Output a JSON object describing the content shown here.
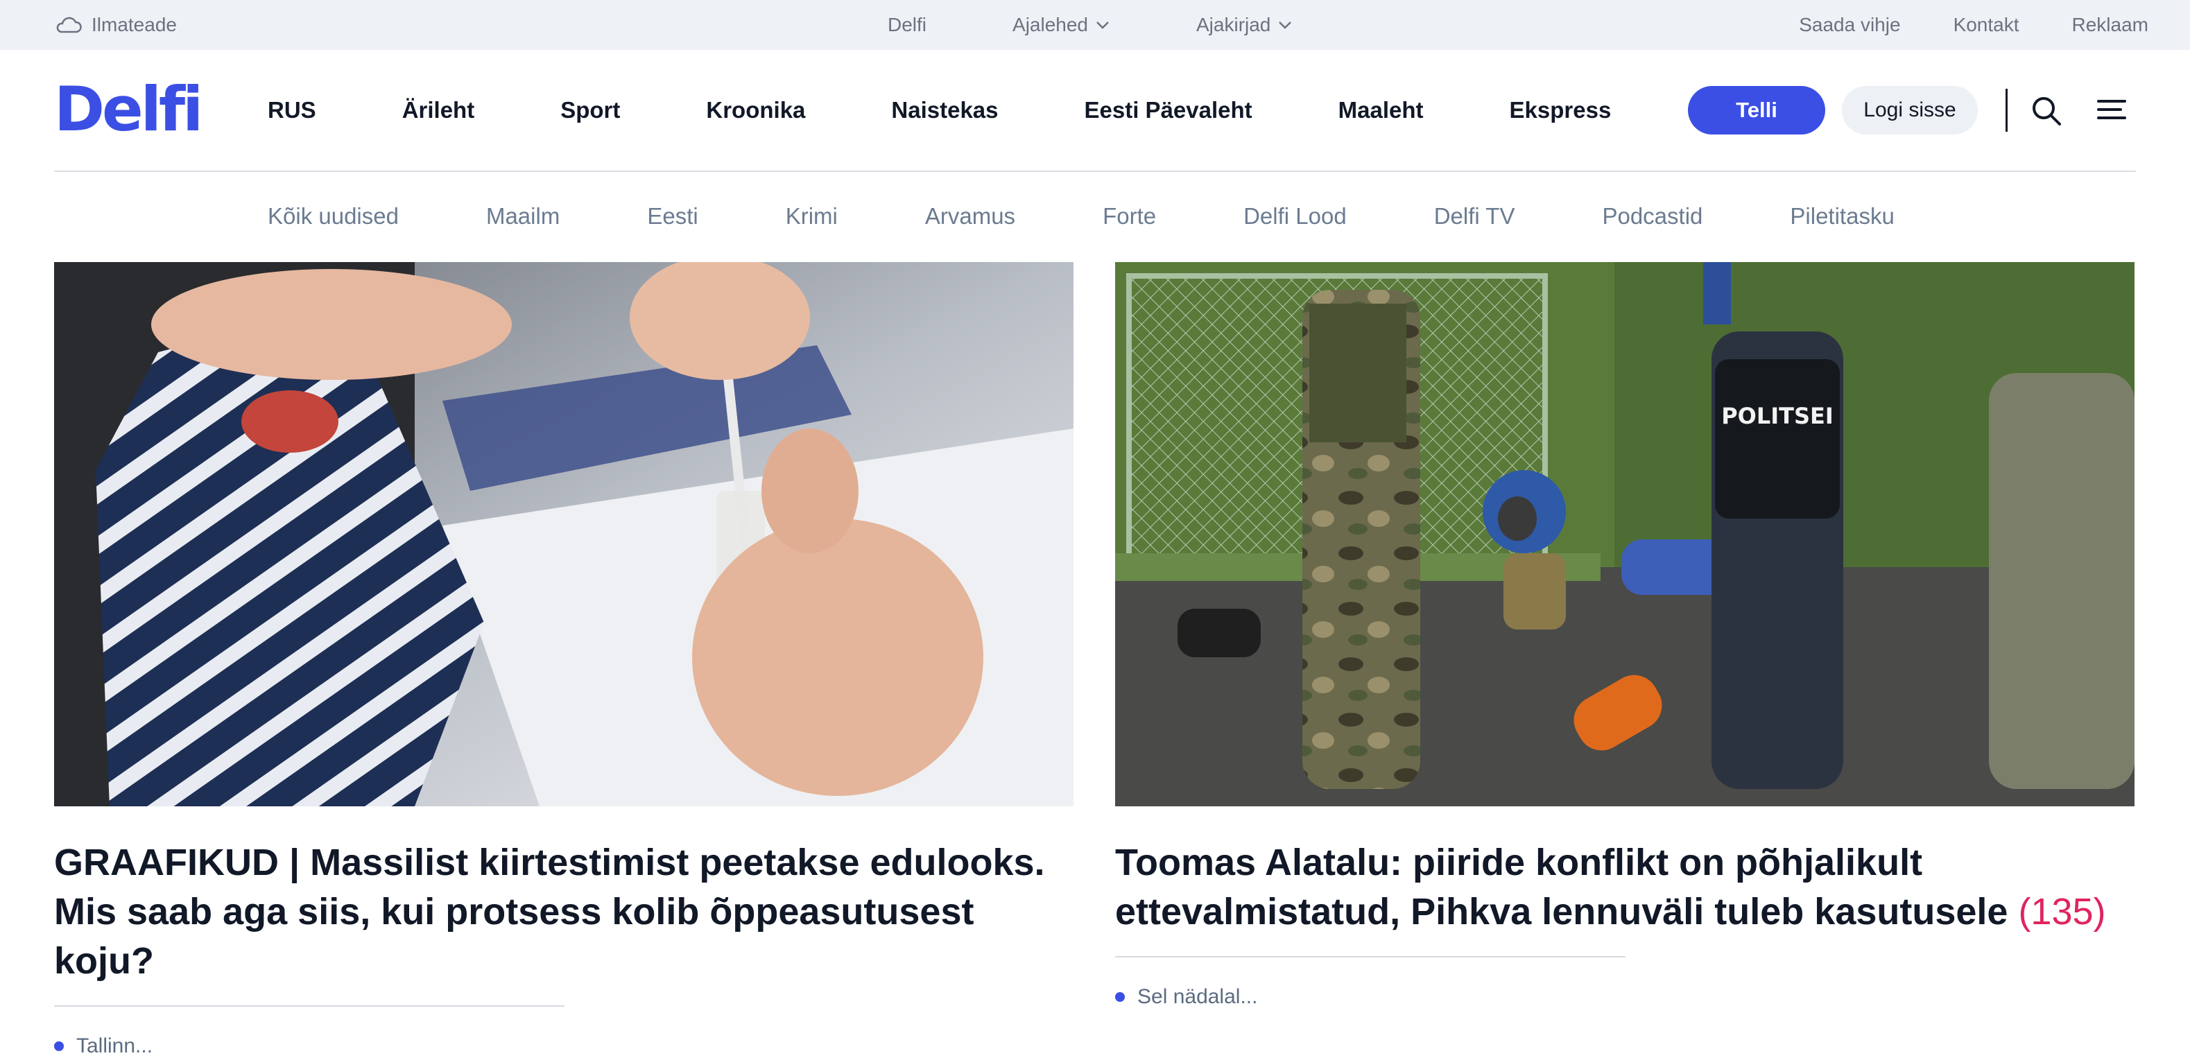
{
  "topbar": {
    "weather_label": "Ilmateade",
    "center_items": [
      {
        "label": "Delfi",
        "has_dropdown": false
      },
      {
        "label": "Ajalehed",
        "has_dropdown": true
      },
      {
        "label": "Ajakirjad",
        "has_dropdown": true
      }
    ],
    "right_links": [
      "Saada vihje",
      "Kontakt",
      "Reklaam"
    ]
  },
  "header": {
    "logo": "Delfi",
    "main_nav": [
      "RUS",
      "Ärileht",
      "Sport",
      "Kroonika",
      "Naistekas",
      "Eesti Päevaleht",
      "Maaleht",
      "Ekspress"
    ],
    "subscribe_label": "Telli",
    "login_label": "Logi sisse",
    "icons": [
      "search-icon",
      "menu-icon"
    ]
  },
  "sub_nav": [
    "Kõik uudised",
    "Maailm",
    "Eesti",
    "Krimi",
    "Arvamus",
    "Forte",
    "Delfi Lood",
    "Delfi TV",
    "Podcastid",
    "Piletitasku"
  ],
  "articles": [
    {
      "headline": "GRAAFIKUD | Massilist kiirtestimist peetakse edulooks. Mis saab aga siis, kui protsess kolib õppeasutusest koju?",
      "comment_count": "",
      "lead": "Tallinn..."
    },
    {
      "headline": "Toomas Alatalu: piiride konflikt on põhjalikult ettevalmistatud, Pihkva lennuväli tuleb kasutusele",
      "comment_count": "(135)",
      "lead": "Sel nädalal..."
    }
  ],
  "colors": {
    "brand": "#3b4fe4",
    "topbar_bg": "#eef1f5",
    "comment_count": "#e0245e",
    "subnav_text": "#6b7b90"
  }
}
